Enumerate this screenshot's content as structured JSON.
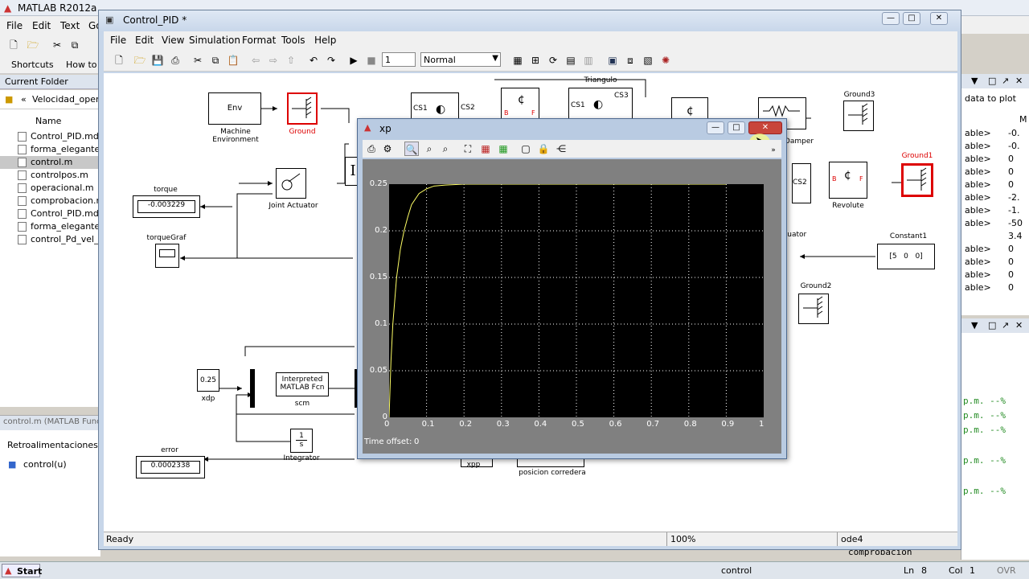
{
  "matlab": {
    "title": "MATLAB  R2012a",
    "menu": [
      "File",
      "Edit",
      "Text",
      "Go"
    ],
    "shortcuts": "Shortcuts",
    "howto": "How to",
    "current_folder": "Current Folder",
    "path": "Velocidad_opera",
    "name_col": "Name",
    "files": [
      "Control_PID.mdl",
      "forma_elegante.m",
      "control.m",
      "controlpos.m",
      "operacional.m",
      "comprobacion.m",
      "Control_PID.mdl",
      "forma_elegante.m",
      "control_Pd_vel_o"
    ],
    "detail_title": "control.m (MATLAB Func",
    "detail_section": "Retroalimentaciones",
    "detail_item": "control(u)",
    "right_header": "data to plot",
    "right_col": "M",
    "right_rows": [
      [
        "able>",
        "-0."
      ],
      [
        "able>",
        "-0."
      ],
      [
        "able>",
        "0"
      ],
      [
        "able>",
        "0"
      ],
      [
        "able>",
        "0"
      ],
      [
        "able>",
        "-2."
      ],
      [
        "able>",
        "-1."
      ],
      [
        "able>",
        "-50"
      ],
      [
        "",
        "3.4"
      ],
      [
        "able>",
        "0"
      ],
      [
        "able>",
        "0"
      ],
      [
        "able>",
        "0"
      ],
      [
        "able>",
        "0"
      ]
    ],
    "cmd_lines": [
      "p.m. --%",
      "p.m. --%",
      "p.m. --%",
      "p.m. --%",
      "p.m. --%"
    ],
    "cmd_bottom": "comprobacion",
    "taskbar": {
      "start": "Start",
      "control": "control",
      "ln_label": "Ln",
      "ln": "8",
      "col_label": "Col",
      "col": "1",
      "ovr": "OVR"
    }
  },
  "simulink": {
    "title": "Control_PID *",
    "menu": [
      "File",
      "Edit",
      "View",
      "Simulation",
      "Format",
      "Tools",
      "Help"
    ],
    "stop_time": "1",
    "mode": "Normal",
    "status": "Ready",
    "zoom": "100%",
    "solver": "ode4",
    "blocks": {
      "env": "Env",
      "machine_env": "Machine\nEnvironment",
      "ground": "Ground",
      "ground1": "Ground1",
      "ground2": "Ground2",
      "ground3": "Ground3",
      "joint_actuator": "Joint Actuator",
      "torque": "torque",
      "torque_val": "-0.003229",
      "torque_graf": "torqueGraf",
      "xdp": "xdp",
      "xdp_val": "0.25",
      "interp": "Interpreted\nMATLAB Fcn",
      "scm": "scm",
      "integrator": "Integrator",
      "int_num": "1",
      "int_den": "s",
      "error": "error",
      "error_val": "0.0002338",
      "xpp": "xpp",
      "posicion": "posicion corredera",
      "error_small": "Error",
      "triangulo": "Triangulo",
      "revolute": "Revolute",
      "damper": "Damper",
      "actuator": "ctuator",
      "constant1": "Constant1",
      "const_val": "[5   0   0]",
      "cs1": "CS1",
      "cs2": "CS2",
      "cs3": "CS3",
      "b": "B",
      "f": "F"
    }
  },
  "scope": {
    "title": "xp",
    "time_offset_label": "Time offset:",
    "time_offset": "0"
  },
  "chart_data": {
    "type": "line",
    "title": "xp",
    "xlim": [
      0,
      1
    ],
    "ylim": [
      0,
      0.25
    ],
    "x_ticks": [
      "0",
      "0.1",
      "0.2",
      "0.3",
      "0.4",
      "0.5",
      "0.6",
      "0.7",
      "0.8",
      "0.9",
      "1"
    ],
    "y_ticks": [
      "0",
      "0.05",
      "0.1",
      "0.15",
      "0.2",
      "0.25"
    ],
    "grid": true,
    "line_color": "#ffff66",
    "series": [
      {
        "x": [
          0,
          0.005,
          0.01,
          0.02,
          0.03,
          0.04,
          0.05,
          0.06,
          0.08,
          0.1,
          0.12,
          0.15,
          0.2,
          0.3,
          0.5,
          0.7,
          0.9
        ],
        "y": [
          0,
          0.06,
          0.1,
          0.15,
          0.18,
          0.2,
          0.215,
          0.228,
          0.24,
          0.245,
          0.248,
          0.249,
          0.25,
          0.25,
          0.25,
          0.25,
          0.25
        ]
      }
    ]
  }
}
